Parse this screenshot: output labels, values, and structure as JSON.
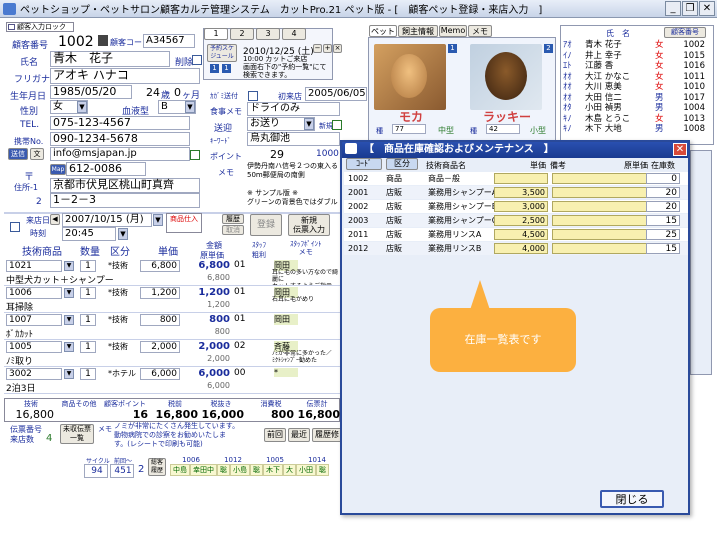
{
  "window": {
    "title": "ペットショップ・ペットサロン顧客カルテ管理システム　カットPro.21 ペット版 - [　顧客ペット登録・来店入力　]"
  },
  "customer": {
    "block_label": "顧客入力ロック",
    "id_label": "顧客番号",
    "id": "1002",
    "code_label": "顧客コード",
    "code": "A34567",
    "name_label": "氏名",
    "name": "青木　花子",
    "delete_label": "削除",
    "kana_label": "フリガナ",
    "kana": "アオキ ハナコ",
    "birth_label": "生年月日",
    "birth": "1985/05/20",
    "age": "24",
    "age_unit": "歳",
    "months": "0",
    "months_unit": "ヶ月",
    "sex_label": "性別",
    "sex": "女",
    "blood_label": "血液型",
    "blood": "B",
    "tel_label": "TEL.",
    "tel": "075-123-4567",
    "mobile_label": "携帯No.",
    "mobile": "090-1234-5678",
    "mail_btn": "送信",
    "mail_btn2": "文",
    "email": "info@msjapan.jp",
    "zip_prefix": "〒",
    "map_btn": "Map",
    "zip": "612-0086",
    "addr_label1": "住所-1",
    "addr1": "京都市伏見区桃山町真齊",
    "addr_label2": "2",
    "addr2": "1－2－3"
  },
  "tabs": {
    "t1": "1",
    "t2": "2",
    "t3": "3",
    "t4": "4"
  },
  "reserve": {
    "btn": "予約スケジュール",
    "date": "2010/12/25 (土)",
    "text": "10:00 カットご来店\n画面右下の\"予約一覧\"にて検索できます。"
  },
  "right_info": {
    "dm_label": "ｶｶﾞﾐ送付",
    "first_label": "初来店",
    "first_date": "2005/06/05",
    "food_label": "食事メモ",
    "food": "ドライのみ",
    "send_label": "送迎",
    "send": "お送り",
    "new_label": "新規",
    "keyword_label": "ｷｰﾜｰﾄﾞ",
    "keyword": "烏丸御池",
    "points_label": "ポイント",
    "points": "29",
    "points2": "1000",
    "memo_label": "メモ",
    "memo": "伊勢丹南ハ信号２つの東入る\n50m郵便局の南側\n\n※ サンプル版 ※\nグリーンの背景色ではダブル"
  },
  "pets": {
    "tabs": [
      "ペット",
      "飼主情報",
      "Memo",
      "メモ"
    ],
    "pet1": {
      "name": "モカ",
      "kind_label": "種",
      "kind": "77",
      "size": "中型"
    },
    "pet2": {
      "name": "ラッキー",
      "kind_label": "種",
      "kind": "42",
      "size": "小型"
    }
  },
  "kana_index": {
    "header_name": "氏　名",
    "header_no": "顧客番号",
    "rows": [
      {
        "k": "ｱｵ",
        "name": "青木 花子",
        "sex": "女",
        "no": "1002"
      },
      {
        "k": "ｲﾉ",
        "name": "井上 幸子",
        "sex": "女",
        "no": "1015"
      },
      {
        "k": "ｴﾄ",
        "name": "江藤 香",
        "sex": "女",
        "no": "1016"
      },
      {
        "k": "ｵｵ",
        "name": "大江 かなこ",
        "sex": "女",
        "no": "1011"
      },
      {
        "k": "ｵｵ",
        "name": "大川 恵美",
        "sex": "女",
        "no": "1010"
      },
      {
        "k": "ｵｵ",
        "name": "大田 信二",
        "sex": "男",
        "no": "1017"
      },
      {
        "k": "ｵﾀ",
        "name": "小田 禎男",
        "sex": "男",
        "no": "1004"
      },
      {
        "k": "ｷﾉ",
        "name": "木島 とうこ",
        "sex": "女",
        "no": "1013"
      },
      {
        "k": "ｷﾉ",
        "name": "木下 大地",
        "sex": "男",
        "no": "1008"
      }
    ]
  },
  "visit": {
    "label": "来店日",
    "date": "2007/10/15 (月)",
    "time_label": "時刻",
    "time": "20:45",
    "product_btn": "商品仕入",
    "history": "履歴",
    "cancel": "取消",
    "register": "登録",
    "new_input": "新規\n伝票入力",
    "cols": {
      "item": "技術商品",
      "qty": "数量",
      "div": "区分",
      "price": "単価",
      "amount": "金額",
      "cost": "原単価",
      "staff": "ｽﾀｯﾌ",
      "profit": "粗利",
      "memo": "ｽﾀｯﾌﾎﾟｲﾝﾄ\nメモ"
    },
    "rows": [
      {
        "code": "1021",
        "qty": "1",
        "div": "*技術",
        "price": "6,800",
        "amount": "6,800",
        "staff": "01",
        "name": "中型犬カット＋シャンプー",
        "cost": "6,800",
        "memo1": "岡田",
        "memo2": "耳に毛の多い方なので綺麗に\nカットするようご指示"
      },
      {
        "code": "1006",
        "qty": "1",
        "div": "*技術",
        "price": "1,200",
        "amount": "1,200",
        "staff": "01",
        "name": "耳掃除",
        "cost": "1,200",
        "memo1": "岡田",
        "memo2": "右耳に毛がめり"
      },
      {
        "code": "1007",
        "qty": "1",
        "div": "*技術",
        "price": "800",
        "amount": "800",
        "staff": "01",
        "name": "ﾎﾞｶｶｯﾄ",
        "cost": "800",
        "memo1": "岡田",
        "memo2": ""
      },
      {
        "code": "1005",
        "qty": "1",
        "div": "*技術",
        "price": "2,000",
        "amount": "2,000",
        "staff": "02",
        "name": "ﾉﾐ取り",
        "cost": "2,000",
        "memo1": "斉藤",
        "memo2": "ﾉﾐが非常に多かった／\nﾐｸﾄｼｬﾝﾌﾟｰ勧めた"
      },
      {
        "code": "3002",
        "qty": "1",
        "div": "*ホテル",
        "price": "6,000",
        "amount": "6,000",
        "staff": "00",
        "name": "2泊3日",
        "cost": "6,000",
        "memo1": "*",
        "memo2": ""
      }
    ],
    "totals_labels": [
      "技術",
      "商品その他",
      "顧客ポイント",
      "税前",
      "税抜き",
      "消費税",
      "伝票計"
    ],
    "totals": [
      "16,800",
      "",
      "16",
      "16,800",
      "16,000",
      "800",
      "16,800"
    ],
    "slip_label": "伝票番号",
    "slip_no": "4",
    "visits_label": "来店数",
    "visits": "4",
    "unpaid_btn": "未収伝票\n一覧",
    "memo_label": "メモ",
    "memo_text": "ノミが非常にたくさん発生しています。\n動物病院での診察をお勧めいたしま\nす。(レシートで印刷も可能)",
    "prev": "前回",
    "recent": "最近",
    "hist_btn": "履歴修"
  },
  "summary": {
    "cycle_label": "サイクル",
    "cycle": "94",
    "avg_label": "前回〜",
    "avg": "451",
    "count": "2",
    "btn": "総客履歴",
    "staff_codes": [
      "1006",
      "1012",
      "1005",
      "1014"
    ],
    "staff_names": [
      "中島",
      "幸田中",
      "聡",
      "小島",
      "聡",
      "木下",
      "大",
      "小田",
      "聡"
    ]
  },
  "dialog": {
    "title": "【　商品在庫確認およびメンテナンス　】",
    "col_code_btn": "ｺｰﾄﾞ",
    "col_div_btn": "区分",
    "col_name": "技術商品名",
    "col_price": "単価",
    "col_note": "備考",
    "col_cost": "原単価",
    "col_stock": "在庫数",
    "rows": [
      {
        "code": "1002",
        "div": "商品",
        "name": "商品－般",
        "price": "",
        "stock": "0"
      },
      {
        "code": "2001",
        "div": "店販",
        "name": "業務用シャンプーA",
        "price": "3,500",
        "stock": "20"
      },
      {
        "code": "2002",
        "div": "店販",
        "name": "業務用シャンプーB",
        "price": "3,000",
        "stock": "20"
      },
      {
        "code": "2003",
        "div": "店販",
        "name": "業務用シャンプーC",
        "price": "2,500",
        "stock": "15"
      },
      {
        "code": "2011",
        "div": "店販",
        "name": "業務用リンスA",
        "price": "4,500",
        "stock": "25"
      },
      {
        "code": "2012",
        "div": "店販",
        "name": "業務用リンスB",
        "price": "4,000",
        "stock": "15"
      }
    ],
    "close_btn": "閉じる"
  },
  "callout": {
    "text": "在庫一覧表です"
  },
  "colors": {
    "accent": "#1a2c9c",
    "callout": "#fcb040",
    "dialog_title": "#1a3a90",
    "row_highlight": "#f8f0b0"
  }
}
